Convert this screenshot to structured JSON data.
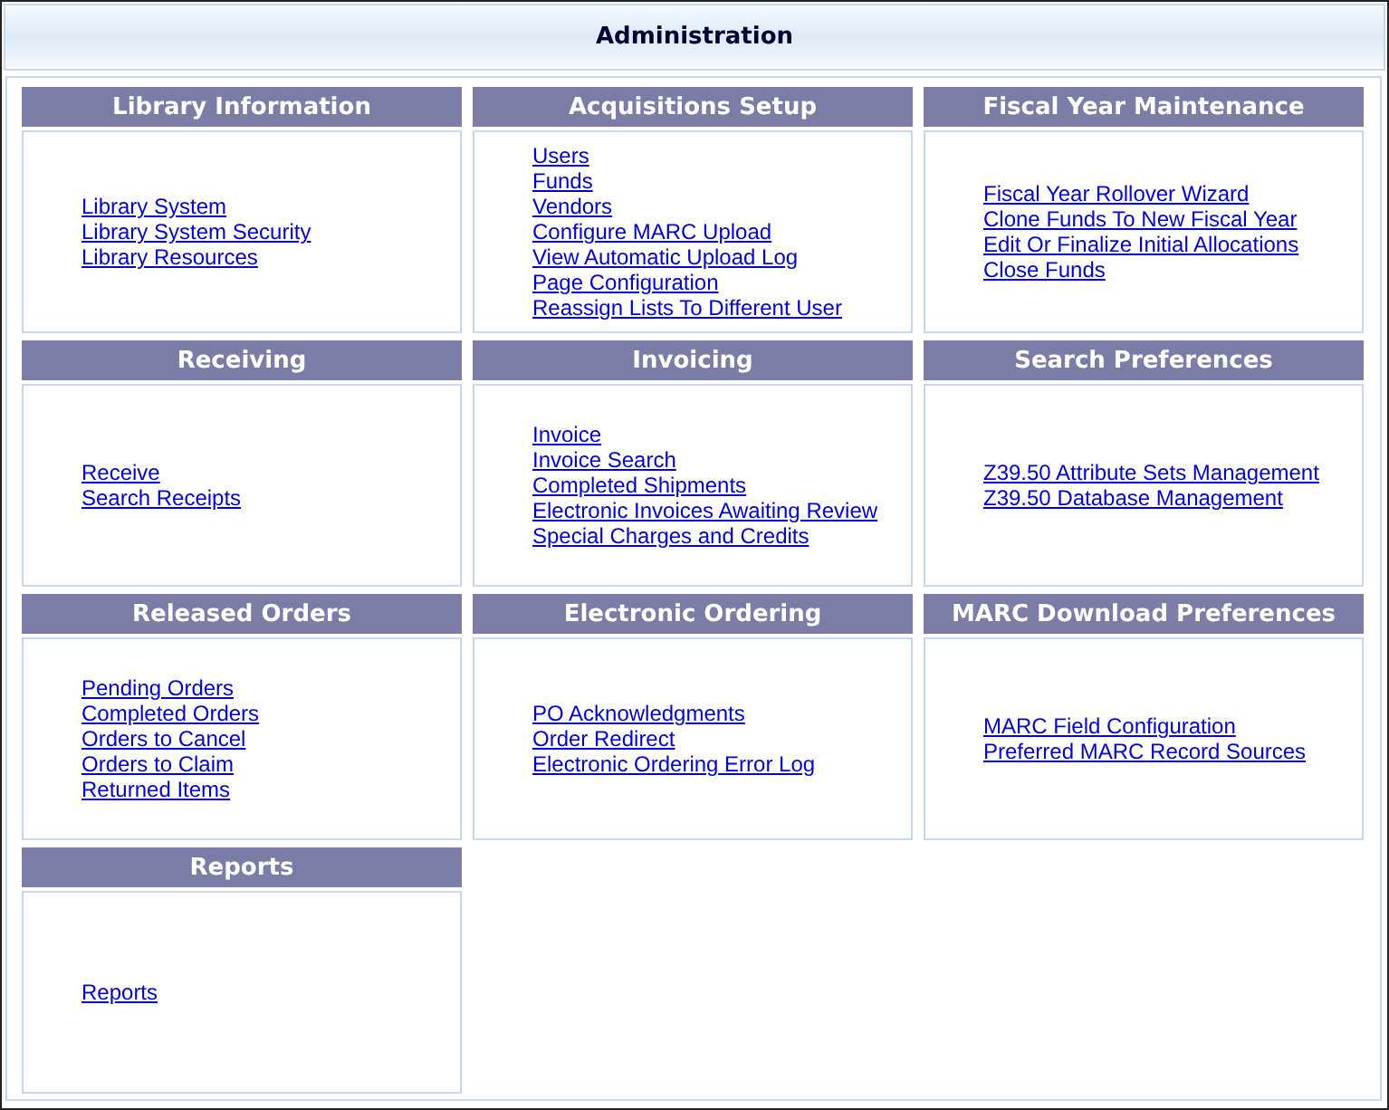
{
  "window": {
    "title": "Administration"
  },
  "sections": [
    {
      "title": "Library Information",
      "links": [
        "Library System",
        "Library System Security",
        "Library Resources"
      ]
    },
    {
      "title": "Acquisitions Setup",
      "links": [
        "Users",
        "Funds",
        "Vendors",
        "Configure MARC Upload",
        "View Automatic Upload Log",
        "Page Configuration",
        "Reassign Lists To Different User"
      ]
    },
    {
      "title": "Fiscal Year Maintenance",
      "links": [
        "Fiscal Year Rollover Wizard",
        "Clone Funds To New Fiscal Year",
        "Edit Or Finalize Initial Allocations",
        "Close Funds"
      ]
    },
    {
      "title": "Receiving",
      "links": [
        "Receive",
        "Search Receipts"
      ]
    },
    {
      "title": "Invoicing",
      "links": [
        "Invoice",
        "Invoice Search",
        "Completed Shipments",
        "Electronic Invoices Awaiting Review",
        "Special Charges and Credits"
      ]
    },
    {
      "title": "Search Preferences",
      "links": [
        "Z39.50 Attribute Sets Management",
        "Z39.50 Database Management"
      ]
    },
    {
      "title": "Released Orders",
      "links": [
        "Pending Orders",
        "Completed Orders",
        "Orders to Cancel",
        "Orders to Claim",
        "Returned Items"
      ]
    },
    {
      "title": "Electronic Ordering",
      "links": [
        "PO Acknowledgments",
        "Order Redirect",
        "Electronic Ordering Error Log"
      ]
    },
    {
      "title": "MARC Download Preferences",
      "links": [
        "MARC Field Configuration",
        "Preferred MARC Record Sources"
      ]
    },
    {
      "title": "Reports",
      "links": [
        "Reports"
      ]
    }
  ]
}
